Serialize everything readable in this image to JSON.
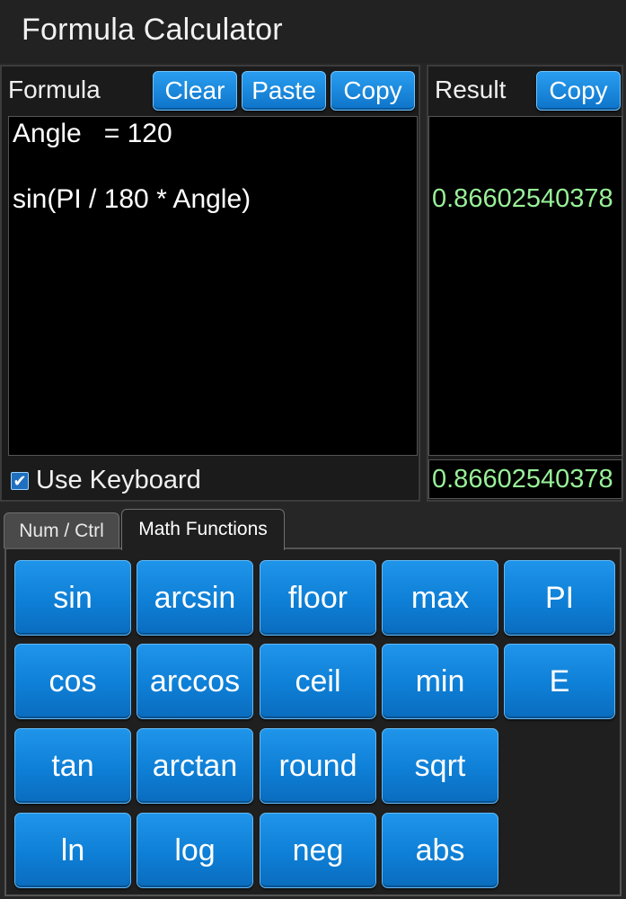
{
  "app": {
    "title": "Formula Calculator"
  },
  "formula_panel": {
    "label": "Formula",
    "clear_label": "Clear",
    "paste_label": "Paste",
    "copy_label": "Copy",
    "lines": [
      "Angle   = 120",
      "",
      "sin(PI / 180 * Angle)"
    ],
    "use_keyboard_label": "Use Keyboard",
    "use_keyboard_checked": true
  },
  "result_panel": {
    "label": "Result",
    "copy_label": "Copy",
    "line_result": "0.86602540378",
    "final_result": "0.86602540378"
  },
  "tabs": [
    {
      "label": "Num / Ctrl",
      "active": false
    },
    {
      "label": "Math Functions",
      "active": true
    }
  ],
  "keys": {
    "r1": [
      "sin",
      "arcsin",
      "floor",
      "max",
      "PI"
    ],
    "r2": [
      "cos",
      "arccos",
      "ceil",
      "min",
      "E"
    ],
    "r3": [
      "tan",
      "arctan",
      "round",
      "sqrt"
    ],
    "r4": [
      "ln",
      "log",
      "neg",
      "abs"
    ]
  },
  "colors": {
    "button_blue": "#1a8ae0",
    "result_green": "#98f098",
    "background": "#262626"
  },
  "icons": {
    "checkbox": "check-icon"
  }
}
